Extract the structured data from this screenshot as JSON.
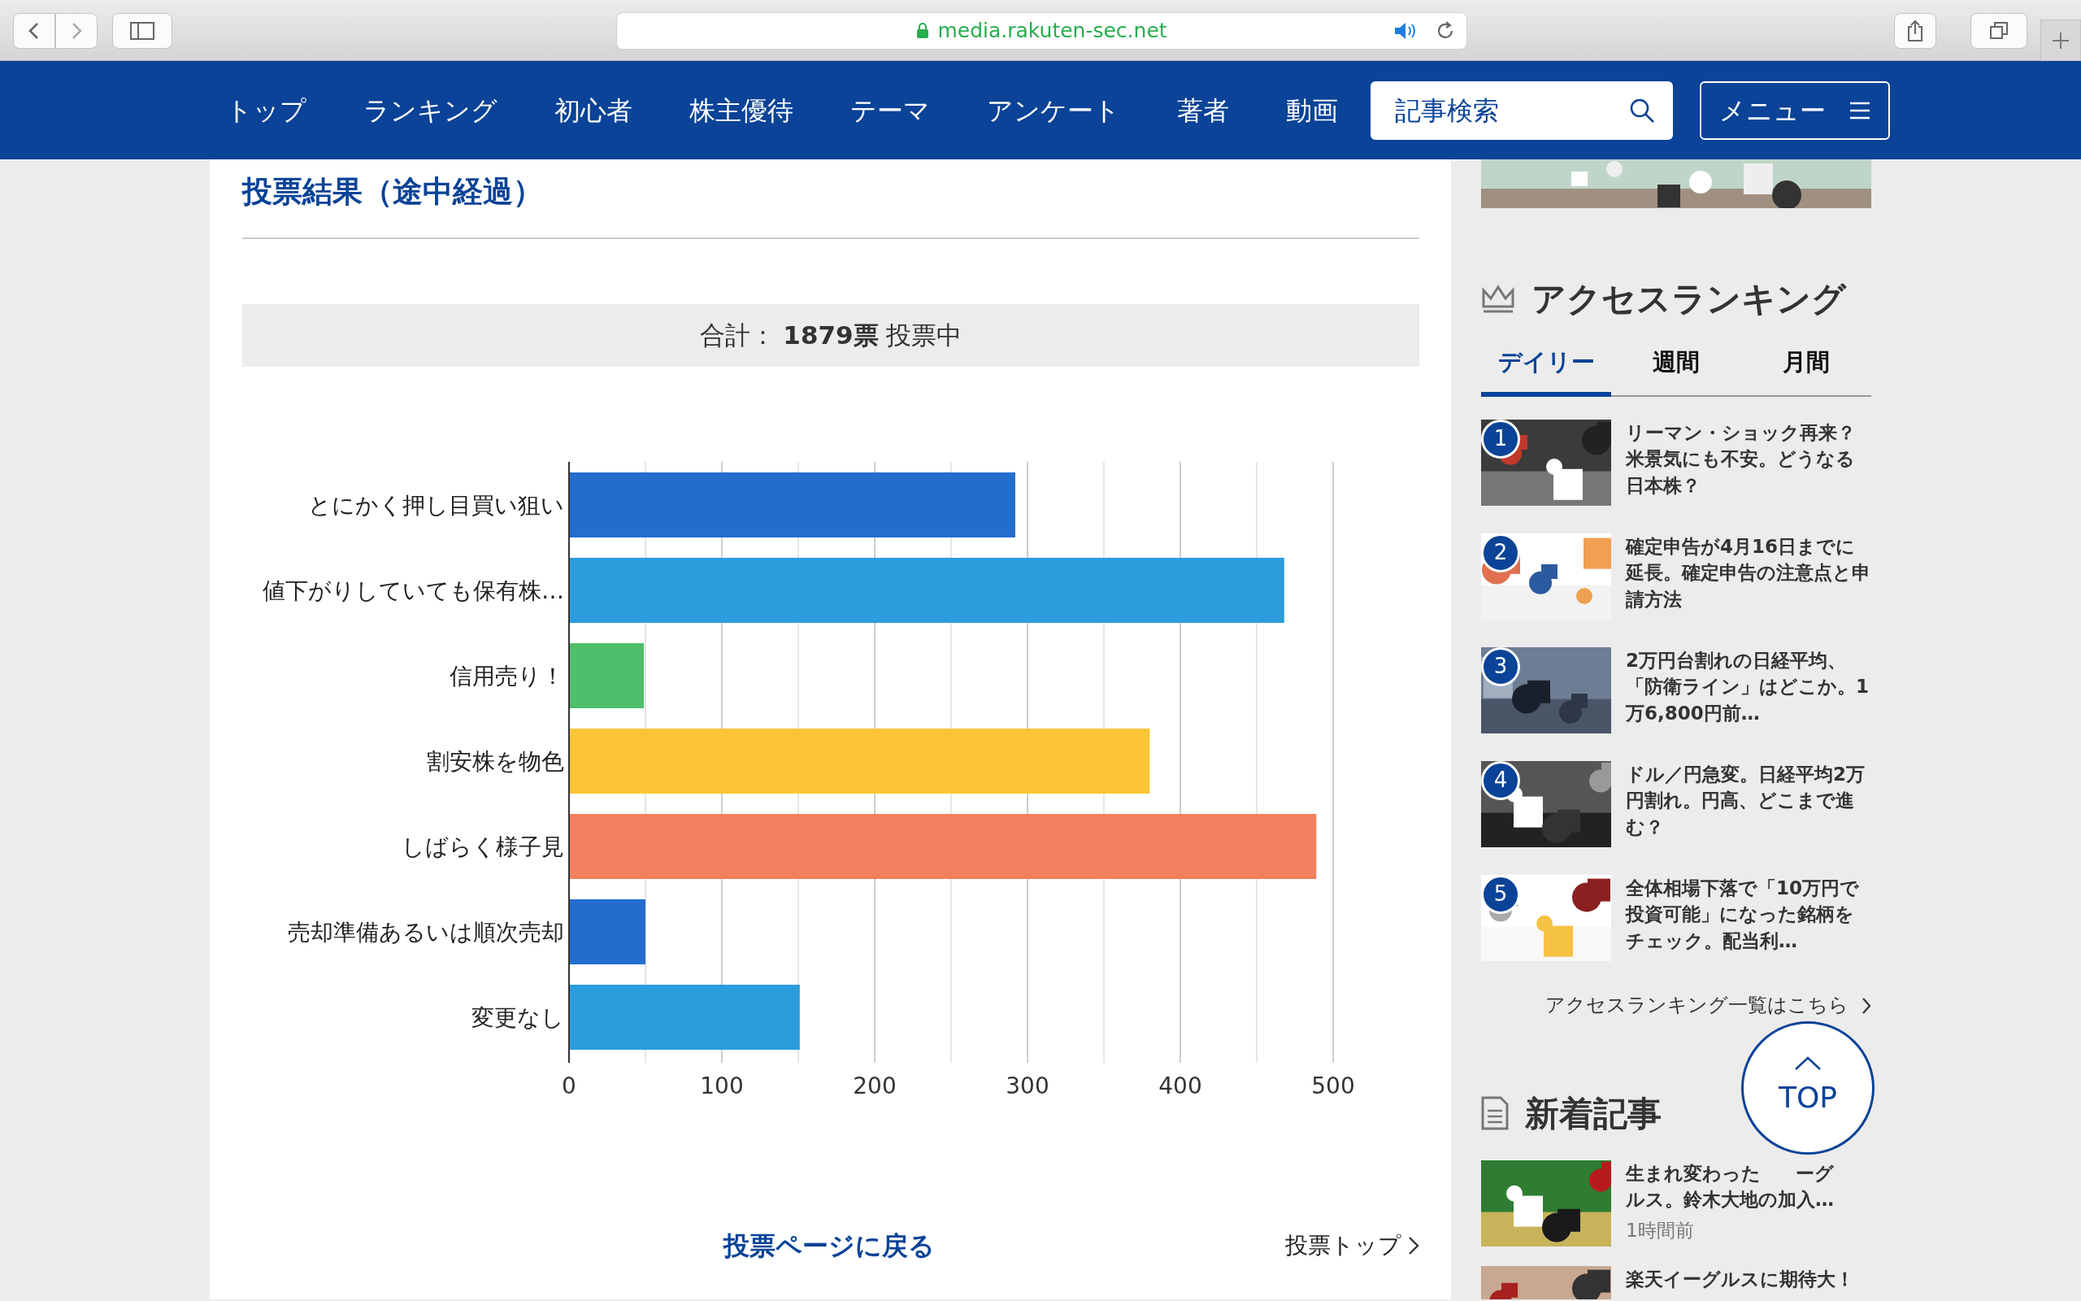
{
  "browser": {
    "url": "media.rakuten-sec.net"
  },
  "nav": {
    "items": [
      "トップ",
      "ランキング",
      "初心者",
      "株主優待",
      "テーマ",
      "アンケート",
      "著者",
      "動画"
    ],
    "search": {
      "placeholder": "記事検索"
    },
    "menu_button": "メニュー"
  },
  "main": {
    "title": "投票結果（途中経過）",
    "total": "合計： **1879票** 投票中",
    "chart_data": {
      "type": "bar",
      "orientation": "horizontal",
      "categories": [
        "とにかく押し目買い狙い",
        "値下がりしていても保有株…",
        "信用売り！",
        "割安株を物色",
        "しばらく様子見",
        "売却準備あるいは順次売却",
        "変更なし"
      ],
      "series": [
        {
          "values": [
            292,
            468,
            49,
            380,
            489,
            50,
            151
          ],
          "colors": [
            "#236dce",
            "#2b9ddd",
            "#4ebf6b",
            "#fbc535",
            "#f27f5d",
            "#236dce",
            "#2b9ddd"
          ]
        }
      ],
      "grid": true,
      "xlim": [
        0,
        500
      ],
      "xticks": [
        0,
        100,
        200,
        300,
        400,
        500
      ]
    },
    "back_link": "投票ページに戻る",
    "top_link": "投票トップ"
  },
  "sidebar": {
    "ranking": {
      "title": "アクセスランキング",
      "tabs": [
        {
          "label": "デイリー",
          "selected": true
        },
        {
          "label": "週間",
          "selected": false
        },
        {
          "label": "月間",
          "selected": false
        }
      ],
      "items": [
        {
          "rank": "1",
          "title": "リーマン・ショック再来？米景気にも不安。どうなる日本株？"
        },
        {
          "rank": "2",
          "title": "確定申告が4月16日までに延長。確定申告の注意点と申請方法"
        },
        {
          "rank": "3",
          "title": "2万円台割れの日経平均、「防衛ライン」はどこか。1万6,800円前…"
        },
        {
          "rank": "4",
          "title": "ドル／円急変。日経平均2万円割れ。円高、どこまで進む？"
        },
        {
          "rank": "5",
          "title": "全体相場下落で「10万円で投資可能」になった銘柄をチェック。配当利…"
        }
      ],
      "more_link": "アクセスランキング一覧はこちら"
    },
    "news": {
      "title": "新着記事",
      "items": [
        {
          "title": [
            "生まれ変わった",
            "ーグ",
            "ルス。鈴木大地の加入…"
          ],
          "time": "1時間前"
        },
        {
          "title": [
            "楽天イーグルスに期待大！"
          ]
        }
      ]
    }
  },
  "top_button": "TOP"
}
